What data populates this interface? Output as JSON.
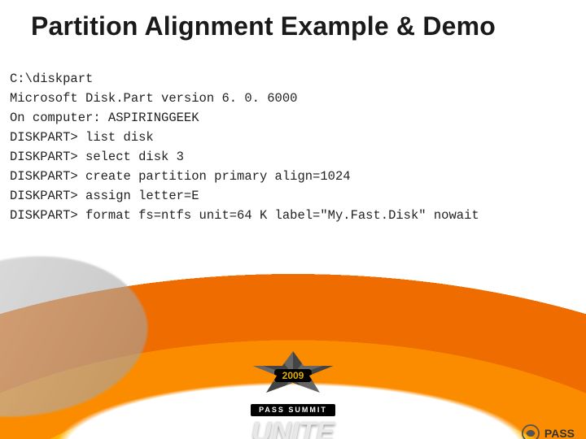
{
  "title": "Partition Alignment Example & Demo",
  "code": {
    "l1": "C:\\diskpart",
    "l2": "Microsoft Disk.Part version 6. 0. 6000",
    "l3": "On computer: ASPIRINGGEEK",
    "l4": "DISKPART> list disk",
    "l5": "DISKPART> select disk 3",
    "l6": "DISKPART> create partition primary align=1024",
    "l7": "DISKPART> assign letter=E",
    "l8": "DISKPART> format fs=ntfs unit=64 K label=\"My.Fast.Disk\" nowait"
  },
  "badge": {
    "year": "2009",
    "bar": "PASS SUMMIT",
    "word": "UNITE"
  },
  "footer_logo": "PASS"
}
